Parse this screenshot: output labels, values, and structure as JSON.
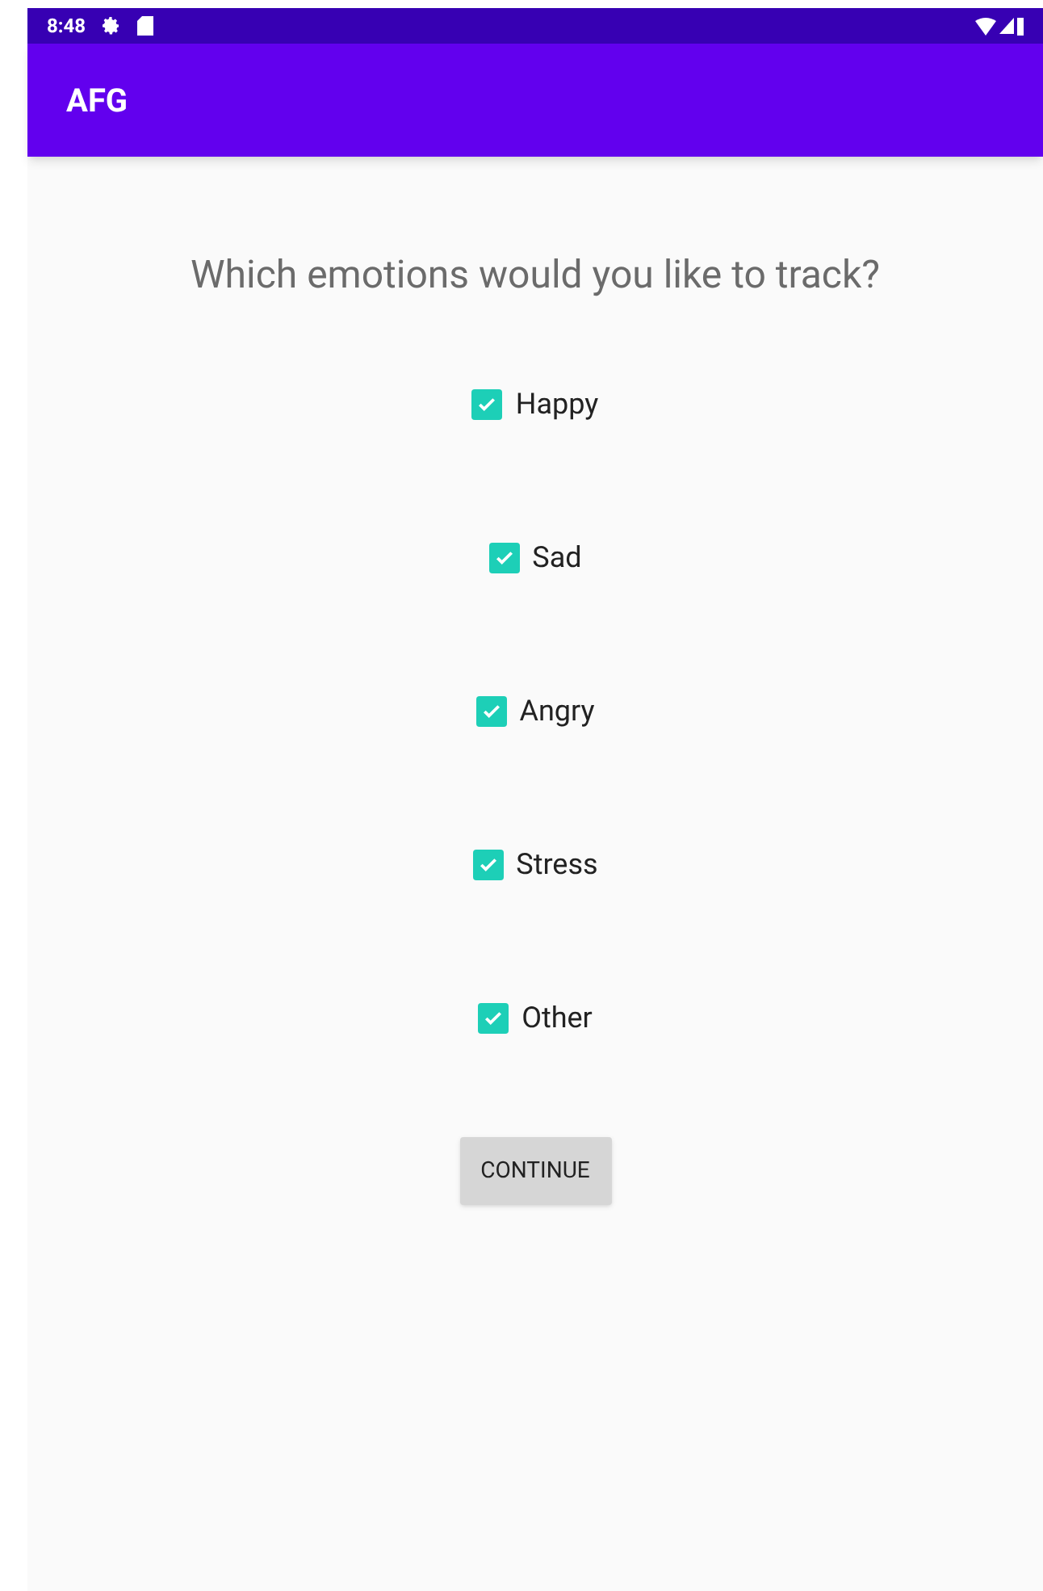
{
  "status_bar": {
    "time": "8:48"
  },
  "app_bar": {
    "title": "AFG"
  },
  "question": "Which emotions would you like to track?",
  "options": [
    {
      "label": "Happy",
      "checked": true
    },
    {
      "label": "Sad",
      "checked": true
    },
    {
      "label": "Angry",
      "checked": true
    },
    {
      "label": "Stress",
      "checked": true
    },
    {
      "label": "Other",
      "checked": true
    }
  ],
  "button": "CONTINUE"
}
